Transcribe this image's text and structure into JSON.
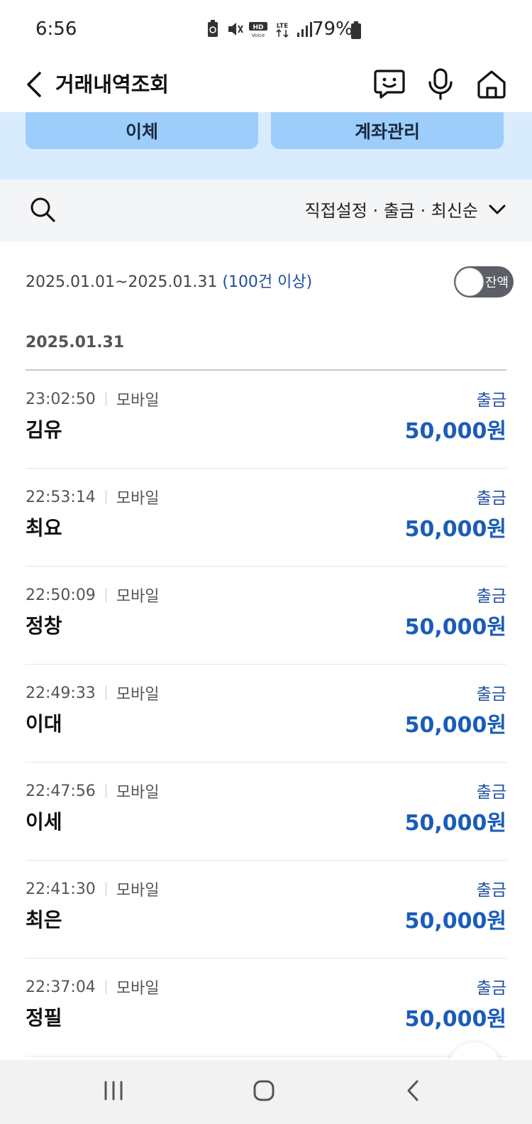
{
  "status_bar": {
    "time": "6:56",
    "battery_text": "79%",
    "icons": [
      "battery-saver-icon",
      "mute-icon",
      "hd-voice-icon",
      "lte-icon",
      "signal-icon",
      "battery-icon"
    ]
  },
  "header": {
    "title": "거래내역조회",
    "back_icon": "chevron-left-icon",
    "actions": [
      "chatbot-icon",
      "microphone-icon",
      "home-icon"
    ]
  },
  "top_panel": {
    "buttons": [
      "이체",
      "계좌관리"
    ]
  },
  "filter": {
    "search_icon": "search-icon",
    "summary": "직접설정 · 출금 · 최신순"
  },
  "period": {
    "range": "2025.01.01~2025.01.31",
    "count": "(100건 이상)",
    "balance_toggle_label": "잔액",
    "balance_toggle_on": false
  },
  "date_group": "2025.01.31",
  "transactions": [
    {
      "time": "23:02:50",
      "channel": "모바일",
      "name": "김유",
      "type": "출금",
      "amount": "50,000원"
    },
    {
      "time": "22:53:14",
      "channel": "모바일",
      "name": "최요",
      "type": "출금",
      "amount": "50,000원"
    },
    {
      "time": "22:50:09",
      "channel": "모바일",
      "name": "정창",
      "type": "출금",
      "amount": "50,000원"
    },
    {
      "time": "22:49:33",
      "channel": "모바일",
      "name": "이대",
      "type": "출금",
      "amount": "50,000원"
    },
    {
      "time": "22:47:56",
      "channel": "모바일",
      "name": "이세",
      "type": "출금",
      "amount": "50,000원"
    },
    {
      "time": "22:41:30",
      "channel": "모바일",
      "name": "최은",
      "type": "출금",
      "amount": "50,000원"
    },
    {
      "time": "22:37:04",
      "channel": "모바일",
      "name": "정필",
      "type": "출금",
      "amount": "50,000원"
    }
  ],
  "colors": {
    "accent_blue": "#1a5cb8",
    "panel_bg": "#d9ecfd",
    "panel_button": "#9dcdfb",
    "filter_bg": "#f4f5f7"
  }
}
